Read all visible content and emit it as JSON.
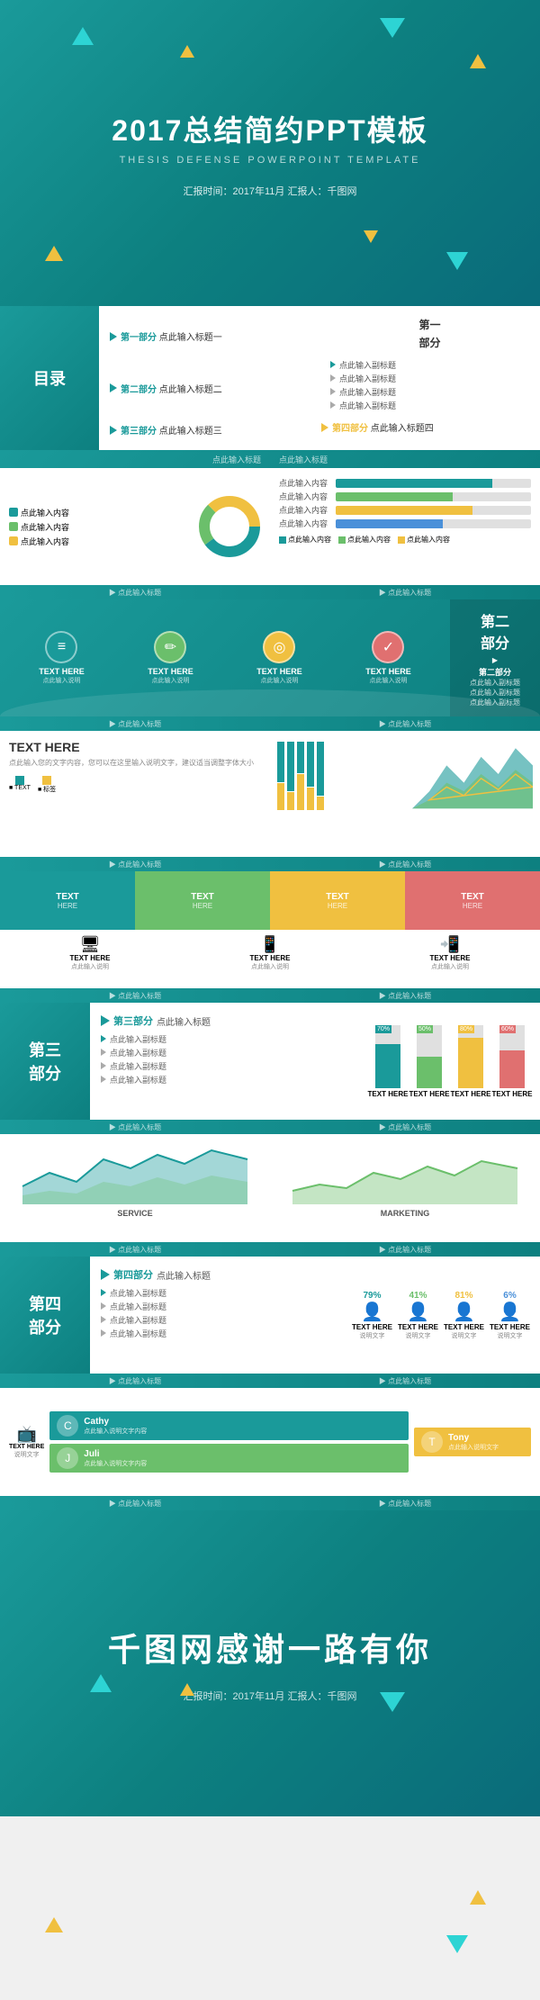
{
  "cover": {
    "main_title": "2017总结简约PPT模板",
    "sub_title": "THESIS DEFENSE POWERPOINT TEMPLATE",
    "meta": "汇报时间：2017年11月   汇报人：千图网"
  },
  "toc": {
    "label": "目录",
    "items": [
      {
        "num": "第一部分",
        "text": "点此输入标题一",
        "color": "teal"
      },
      {
        "num": "第二部分",
        "text": "点此输入标题二",
        "color": "teal"
      },
      {
        "num": "第三部分",
        "text": "点此输入标题三",
        "color": "teal"
      },
      {
        "num": "第四部分",
        "text": "点此输入标题四",
        "color": "yellow"
      }
    ]
  },
  "section1": {
    "label": "第一\n部分",
    "title": "第一部分",
    "heading": "点此输入标题",
    "subitems": [
      "点此输入副标题",
      "点此输入副标题",
      "点此输入副标题",
      "点此输入副标题"
    ]
  },
  "section2": {
    "label": "第二\n部分",
    "title": "第二部分",
    "heading": "点此输入标题",
    "subitems": [
      "点此输入副标题",
      "点此输入副标题",
      "点此输入副标题"
    ]
  },
  "section3": {
    "label": "第三\n部分",
    "title": "第三部分",
    "heading": "点此输入标题",
    "subitems": [
      "点此输入副标题",
      "点此输入副标题",
      "点此输入副标题",
      "点此输入副标题"
    ]
  },
  "section4": {
    "label": "第四\n部分",
    "title": "第四部分",
    "heading": "点此输入标题",
    "subitems": [
      "点此输入副标题",
      "点此输入副标题",
      "点此输入副标题",
      "点此输入副标题"
    ]
  },
  "footer_label": "点此输入标题",
  "placeholder": "点此输入标题",
  "text_here": "TEXT HERE",
  "click_text": "点此输入标题",
  "sample_text": "点此输入您的文字内容，您可以在这里输入说明文字",
  "thankyou": {
    "title": "千图网感谢一路有你",
    "meta": "汇报时间：2017年11月   汇报人：千图网"
  },
  "colors": {
    "teal": "#1a9a9a",
    "teal_light": "#2db8b8",
    "yellow": "#f0c040",
    "green": "#6bbf6b",
    "blue": "#4a90d9",
    "accent1": "#1a9a9a",
    "accent2": "#6bbf6b",
    "accent3": "#f0c040"
  },
  "bars": {
    "chart1": [
      {
        "heights": [
          40,
          55,
          35
        ],
        "colors": [
          "#1a9a9a",
          "#6bbf6b",
          "#f0c040"
        ]
      },
      {
        "heights": [
          50,
          45,
          30
        ],
        "colors": [
          "#1a9a9a",
          "#6bbf6b",
          "#f0c040"
        ]
      },
      {
        "heights": [
          35,
          60,
          45
        ],
        "colors": [
          "#1a9a9a",
          "#6bbf6b",
          "#f0c040"
        ]
      },
      {
        "heights": [
          45,
          50,
          55
        ],
        "colors": [
          "#1a9a9a",
          "#6bbf6b",
          "#f0c040"
        ]
      },
      {
        "heights": [
          55,
          35,
          40
        ],
        "colors": [
          "#1a9a9a",
          "#6bbf6b",
          "#f0c040"
        ]
      }
    ]
  },
  "progress_bars": [
    {
      "label": "点此输入内容",
      "pct": 80,
      "color": "#1a9a9a"
    },
    {
      "label": "点此输入内容",
      "pct": 60,
      "color": "#6bbf6b"
    },
    {
      "label": "点此输入内容",
      "pct": 70,
      "color": "#f0c040"
    },
    {
      "label": "点此输入内容",
      "pct": 50,
      "color": "#4a90d9"
    }
  ],
  "horiz_bars": [
    {
      "pct": 75,
      "color": "#1a9a9a"
    },
    {
      "pct": 55,
      "color": "#6bbf6b"
    },
    {
      "pct": 65,
      "color": "#f0c040"
    },
    {
      "pct": 45,
      "color": "#4a90d9"
    }
  ],
  "icon_boxes": [
    {
      "icon": "≡",
      "color": "#1a9a9a",
      "label": "TEXT HERE"
    },
    {
      "icon": "✏",
      "color": "#6bbf6b",
      "label": "TEXT HERE"
    },
    {
      "icon": "🔍",
      "color": "#f0c040",
      "label": "TEXT HERE"
    },
    {
      "icon": "✓",
      "color": "#e07070",
      "label": "TEXT HERE"
    }
  ],
  "people_stats": [
    {
      "pct": "79%",
      "label": "TEXT HERE",
      "color": "#1a9a9a"
    },
    {
      "pct": "41%",
      "label": "TEXT HERE",
      "color": "#6bbf6b"
    },
    {
      "pct": "81%",
      "label": "TEXT HERE",
      "color": "#f0c040"
    },
    {
      "pct": "6%",
      "label": "TEXT HERE",
      "color": "#4a90d9"
    }
  ],
  "profile_cards": [
    {
      "name": "Cathy",
      "color": "#1a9a9a"
    },
    {
      "name": "Juli",
      "color": "#6bbf6b"
    },
    {
      "name": "Tony",
      "color": "#f0c040"
    }
  ]
}
